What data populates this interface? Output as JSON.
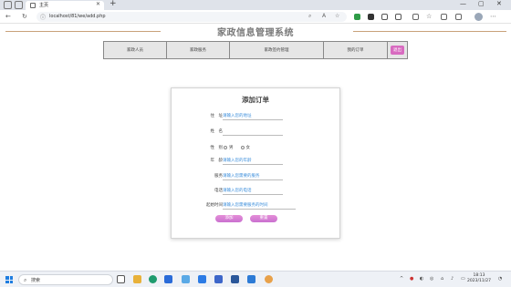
{
  "browser": {
    "tab_title": "主页",
    "url": "localhost/81/we/add.php"
  },
  "page": {
    "site_title": "家政信息管理系统"
  },
  "nav": {
    "items": [
      "家政人员",
      "家政服务",
      "家政签约管理",
      "我的订单"
    ],
    "exit": "退出"
  },
  "form": {
    "title": "添加订单",
    "fields": {
      "address": {
        "label": "住　址",
        "placeholder": "请输入您的地址"
      },
      "name": {
        "label": "姓　名",
        "placeholder": ""
      },
      "gender": {
        "label": "性　别",
        "options": [
          "男",
          "女"
        ]
      },
      "age": {
        "label": "年　龄",
        "placeholder": "请输入您的年龄"
      },
      "service": {
        "label": "服务",
        "placeholder": "请输入您需要的服务"
      },
      "phone": {
        "label": "电话",
        "placeholder": "请输入您的电话"
      },
      "start_time": {
        "label": "起始时间",
        "placeholder": "请输入您需要服务的时间"
      }
    },
    "submit_label": "添加",
    "reset_label": "重置"
  },
  "taskbar": {
    "search_label": "搜索",
    "time": "18:13",
    "date": "2023/11/27"
  },
  "colors": {
    "accent": "#d86bc0",
    "placeholder": "#3a8ddb",
    "decoration": "#c9a27a"
  }
}
